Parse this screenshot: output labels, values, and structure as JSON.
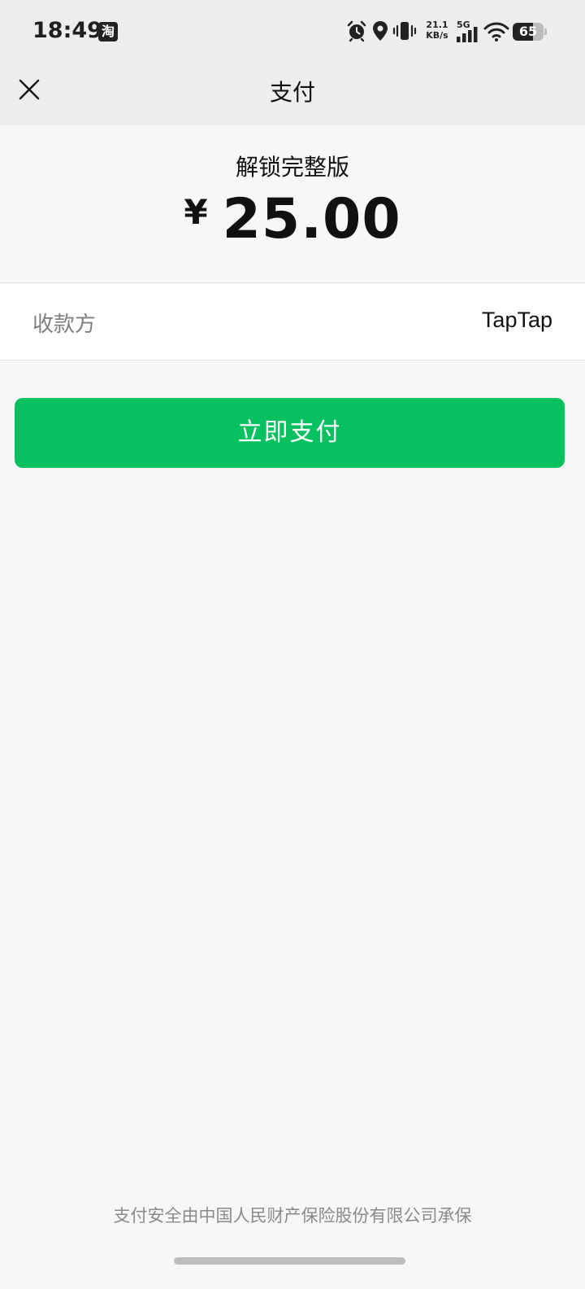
{
  "status_bar": {
    "time": "18:49",
    "app_badge": "淘",
    "net_speed_value": "21.1",
    "net_speed_unit": "KB/s",
    "network_type": "5G",
    "battery_percent": "65",
    "battery_level": 0.65
  },
  "nav": {
    "title": "支付",
    "close_icon": "close-icon"
  },
  "product": {
    "name": "解锁完整版",
    "currency_symbol": "¥",
    "amount": "25.00"
  },
  "payee": {
    "label": "收款方",
    "value": "TapTap"
  },
  "actions": {
    "pay_label": "立即支付"
  },
  "footer": {
    "note": "支付安全由中国人民财产保险股份有限公司承保"
  },
  "colors": {
    "accent": "#07c160",
    "top_bar": "#ededed",
    "background": "#f7f7f7"
  }
}
